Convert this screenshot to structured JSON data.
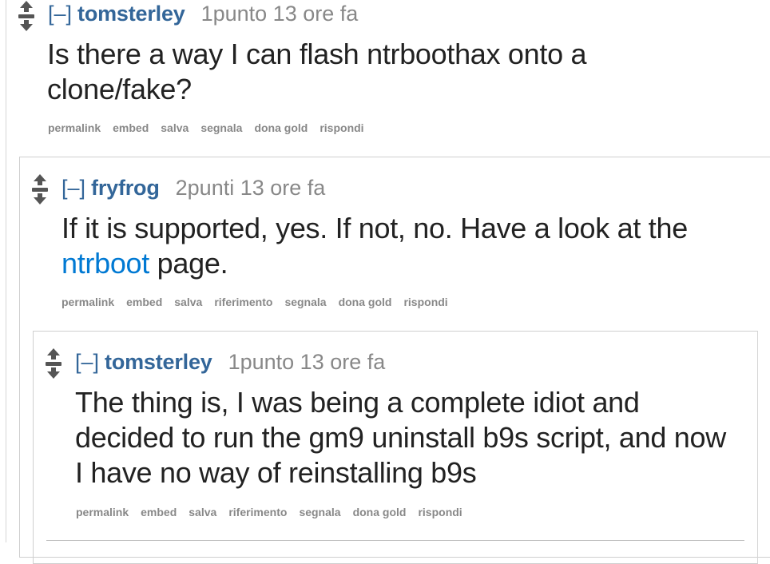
{
  "thread": {
    "toggle_label": "[–]",
    "comments": [
      {
        "author": "tomsterley",
        "score": "1punto 13 ore fa",
        "body": "Is there a way I can flash ntrboothax onto a clone/fake?",
        "actions": [
          "permalink",
          "embed",
          "salva",
          "segnala",
          "dona gold",
          "rispondi"
        ]
      },
      {
        "author": "fryfrog",
        "score": "2punti 13 ore fa",
        "body_pre": "If it is supported, yes. If not, no. Have a look at the",
        "body_link": "ntrboot",
        "body_post": " page.",
        "actions": [
          "permalink",
          "embed",
          "salva",
          "riferimento",
          "segnala",
          "dona gold",
          "rispondi"
        ]
      },
      {
        "author": "tomsterley",
        "score": "1punto 13 ore fa",
        "body": "The thing is, I was being a complete idiot and decided to run the gm9 uninstall b9s script, and now I have no way of reinstalling b9s",
        "actions": [
          "permalink",
          "embed",
          "salva",
          "riferimento",
          "segnala",
          "dona gold",
          "rispondi"
        ]
      }
    ]
  },
  "colors": {
    "author": "#336699",
    "link": "#0079d3",
    "muted": "#888888",
    "text": "#222222"
  }
}
